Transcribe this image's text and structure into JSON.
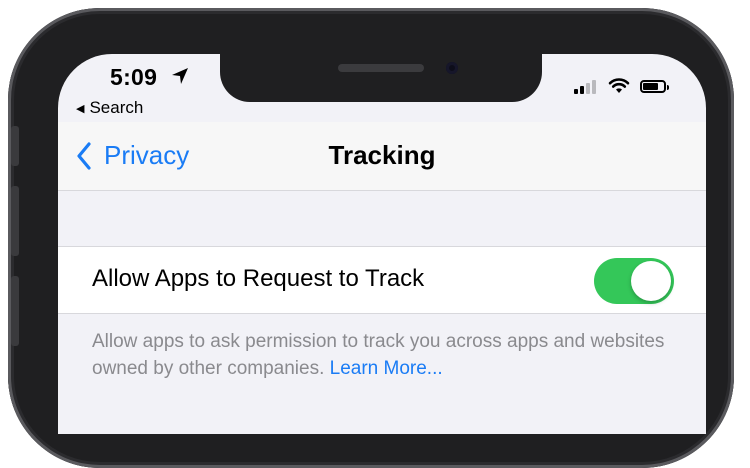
{
  "status_bar": {
    "time": "5:09",
    "back_app_label": "Search",
    "signal_bars": 4,
    "signal_active": 2
  },
  "nav": {
    "back_label": "Privacy",
    "title": "Tracking"
  },
  "settings": {
    "row_label": "Allow Apps to Request to Track",
    "toggle_on": true,
    "footnote_text": "Allow apps to ask permission to track you across apps and websites owned by other companies. ",
    "footnote_link": "Learn More..."
  },
  "colors": {
    "accent": "#1a7cf5",
    "toggle_on": "#34c759",
    "background": "#f2f2f7"
  }
}
